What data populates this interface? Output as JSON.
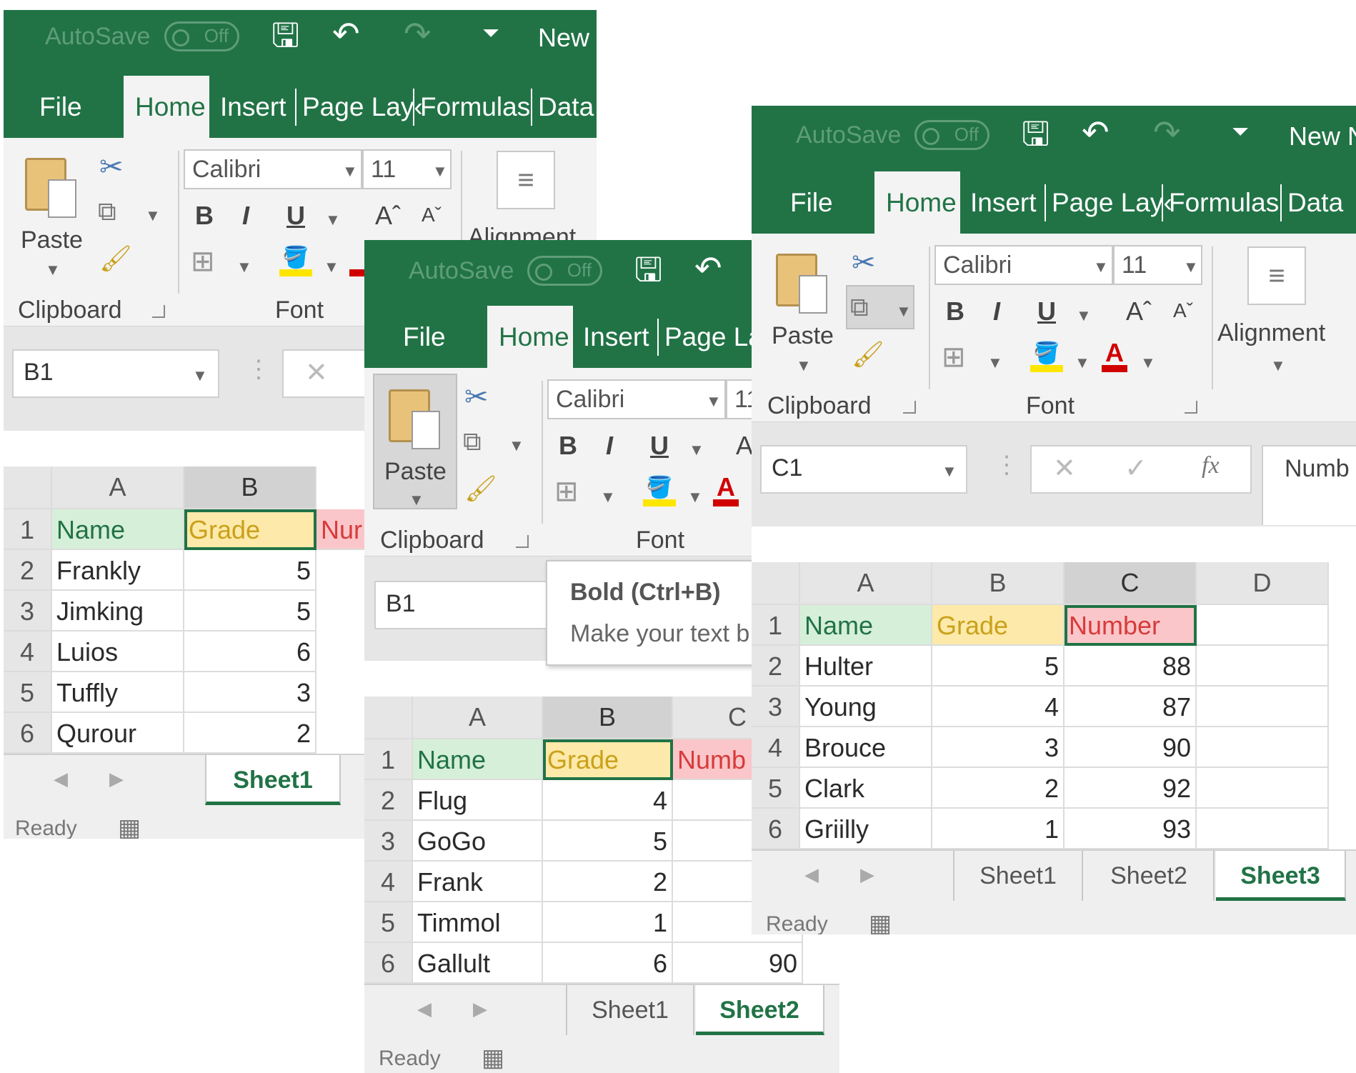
{
  "common": {
    "autosave": "AutoSave",
    "toggle": "Off",
    "title": "New I",
    "title3": "New N",
    "tabs": [
      "File",
      "Home",
      "Insert",
      "Page Lay‹",
      "Formulas",
      "Data"
    ],
    "clipboard": "Clipboard",
    "paste": "Paste",
    "font_group": "Font",
    "alignment": "Alignment",
    "font_name": "Calibri",
    "font_size": "11",
    "bold": "B",
    "italic": "I",
    "underline": "U",
    "grow": "Aˆ",
    "shrink": "Aˇ",
    "ready": "Ready"
  },
  "colors": {
    "excel_green": "#217346",
    "name_fill": "#d6efd9",
    "grade_fill": "#fde9a9",
    "number_fill": "#fbc6c9"
  },
  "window1": {
    "namebox": "B1",
    "columns": [
      "A",
      "B"
    ],
    "header": {
      "name": "Name",
      "grade": "Grade",
      "number": "Nur"
    },
    "rows": [
      {
        "n": "2",
        "name": "Frankly",
        "grade": "5"
      },
      {
        "n": "3",
        "name": "Jimking",
        "grade": "5"
      },
      {
        "n": "4",
        "name": "Luios",
        "grade": "6"
      },
      {
        "n": "5",
        "name": "Tuffly",
        "grade": "3"
      },
      {
        "n": "6",
        "name": "Qurour",
        "grade": "2"
      }
    ],
    "sheets": [
      "Sheet1"
    ]
  },
  "window2": {
    "namebox": "B1",
    "tooltip_title": "Bold (Ctrl+B)",
    "tooltip_body": "Make your text b",
    "columns": [
      "A",
      "B",
      "C"
    ],
    "header": {
      "name": "Name",
      "grade": "Grade",
      "number": "Numb"
    },
    "rows": [
      {
        "n": "2",
        "name": "Flug",
        "grade": "4",
        "number": ""
      },
      {
        "n": "3",
        "name": "GoGo",
        "grade": "5",
        "number": ""
      },
      {
        "n": "4",
        "name": "Frank",
        "grade": "2",
        "number": ""
      },
      {
        "n": "5",
        "name": "Timmol",
        "grade": "1",
        "number": ""
      },
      {
        "n": "6",
        "name": "Gallult",
        "grade": "6",
        "number": "90"
      }
    ],
    "sheets": [
      "Sheet1",
      "Sheet2"
    ]
  },
  "window3": {
    "namebox": "C1",
    "formula": "Numb",
    "fx": "fx",
    "columns": [
      "A",
      "B",
      "C",
      "D"
    ],
    "header": {
      "name": "Name",
      "grade": "Grade",
      "number": "Number"
    },
    "rows": [
      {
        "n": "2",
        "name": "Hulter",
        "grade": "5",
        "number": "88"
      },
      {
        "n": "3",
        "name": "Young",
        "grade": "4",
        "number": "87"
      },
      {
        "n": "4",
        "name": "Brouce",
        "grade": "3",
        "number": "90"
      },
      {
        "n": "5",
        "name": "Clark",
        "grade": "2",
        "number": "92"
      },
      {
        "n": "6",
        "name": "Griilly",
        "grade": "1",
        "number": "93"
      }
    ],
    "sheets": [
      "Sheet1",
      "Sheet2",
      "Sheet3"
    ]
  }
}
